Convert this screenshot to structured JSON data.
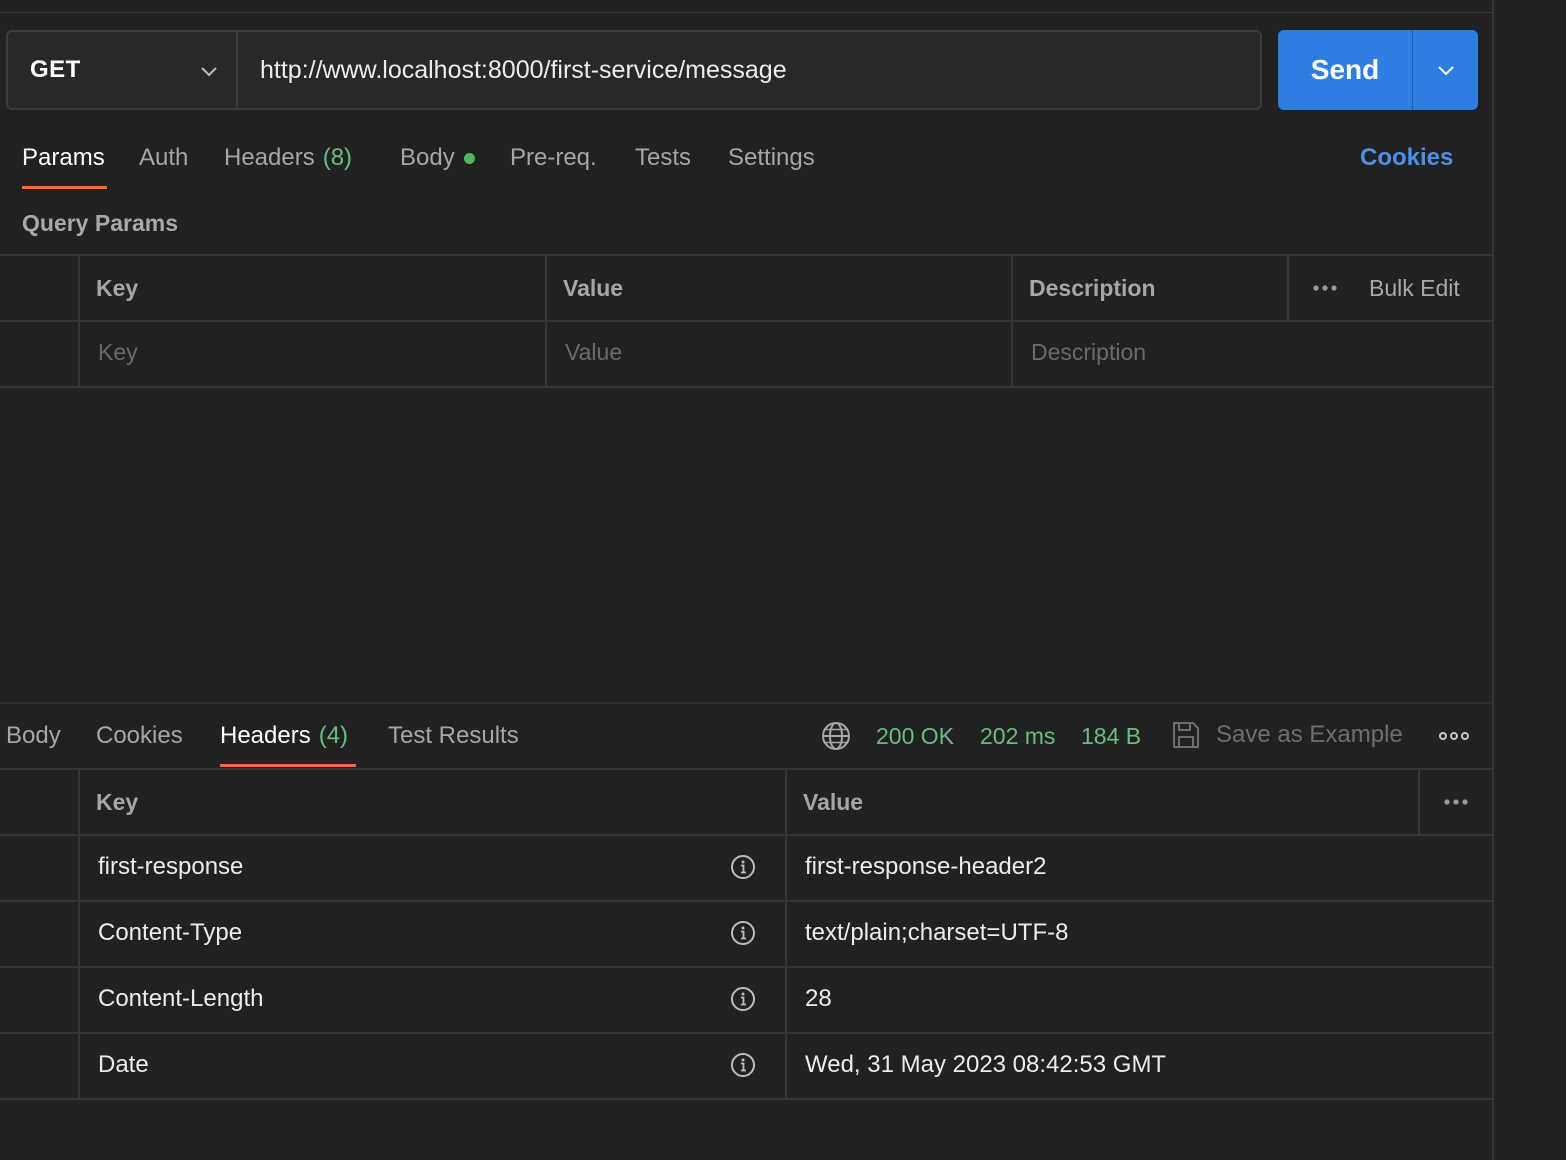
{
  "request": {
    "method": "GET",
    "url": "http://www.localhost:8000/first-service/message",
    "send_label": "Send"
  },
  "request_tabs": {
    "params": "Params",
    "auth": "Auth",
    "headers": "Headers",
    "headers_count": "(8)",
    "body": "Body",
    "prereq": "Pre-req.",
    "tests": "Tests",
    "settings": "Settings",
    "cookies": "Cookies",
    "active": "Params"
  },
  "query_params": {
    "title": "Query Params",
    "columns": {
      "key": "Key",
      "value": "Value",
      "description": "Description"
    },
    "bulk_edit": "Bulk Edit",
    "placeholders": {
      "key": "Key",
      "value": "Value",
      "description": "Description"
    }
  },
  "response_tabs": {
    "body": "Body",
    "cookies": "Cookies",
    "headers": "Headers",
    "headers_count": "(4)",
    "test_results": "Test Results",
    "active": "Headers"
  },
  "response_status": {
    "status": "200 OK",
    "time": "202 ms",
    "size": "184 B",
    "save_as_example": "Save as Example"
  },
  "response_headers": {
    "columns": {
      "key": "Key",
      "value": "Value"
    },
    "rows": [
      {
        "key": "first-response",
        "value": "first-response-header2"
      },
      {
        "key": "Content-Type",
        "value": "text/plain;charset=UTF-8"
      },
      {
        "key": "Content-Length",
        "value": "28"
      },
      {
        "key": "Date",
        "value": "Wed, 31 May 2023 08:42:53 GMT"
      }
    ]
  },
  "colors": {
    "background": "#212121",
    "accent_blue": "#2f7de1",
    "tab_underline": "#f26b3a",
    "status_green": "#6bbd7f",
    "link_blue": "#4c90e9"
  },
  "icons": [
    "chevron-down-icon",
    "globe-icon",
    "save-icon",
    "more-horizontal-icon",
    "info-icon"
  ]
}
